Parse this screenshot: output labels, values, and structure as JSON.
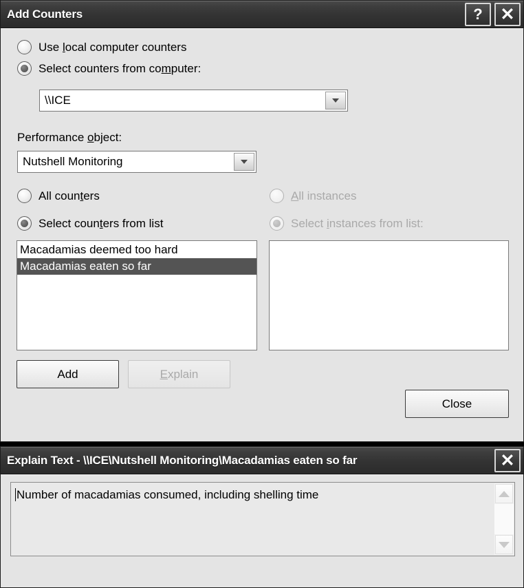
{
  "add_counters_window": {
    "title": "Add Counters",
    "title_buttons": {
      "help": "?",
      "close": "✕"
    },
    "source": {
      "local_option_label_pre": "Use ",
      "local_option_accel": "l",
      "local_option_label_post": "ocal computer counters",
      "remote_option_label_pre": "Select counters from co",
      "remote_option_accel": "m",
      "remote_option_label_post": "puter:",
      "selected": "remote",
      "computer_value": "\\\\ICE"
    },
    "performance_object": {
      "label_pre": "Performance ",
      "label_accel": "o",
      "label_post": "bject:",
      "value": "Nutshell Monitoring"
    },
    "counters": {
      "all_label_pre": "All coun",
      "all_label_accel": "t",
      "all_label_post": "ers",
      "select_label_pre": "Select coun",
      "select_label_accel": "t",
      "select_label_post": "ers from list",
      "selected": "select_from_list",
      "items": [
        {
          "label": "Macadamias deemed too hard",
          "selected": false
        },
        {
          "label": "Macadamias eaten so far",
          "selected": true
        }
      ]
    },
    "instances": {
      "all_label_pre": "",
      "all_label_accel": "A",
      "all_label_post": "ll instances",
      "select_label_pre": "Select ",
      "select_label_accel": "i",
      "select_label_post": "nstances from list:",
      "selected": "select_from_list",
      "disabled": true,
      "items": []
    },
    "buttons": {
      "add": "Add",
      "explain_pre": "",
      "explain_accel": "E",
      "explain_post": "xplain",
      "explain_disabled": true,
      "close": "Close"
    }
  },
  "explain_text_window": {
    "title": "Explain Text - \\\\ICE\\Nutshell Monitoring\\Macadamias eaten so far",
    "title_buttons": {
      "close": "✕"
    },
    "body_text": "Number of macadamias consumed, including shelling time",
    "scrollbar": {
      "up": "scroll-up",
      "down": "scroll-down",
      "disabled": true
    }
  },
  "colors": {
    "titlebar_dark": "#333333",
    "dialog_face": "#e4e4e4",
    "selection": "#545454",
    "disabled_text": "#a9a9a9"
  }
}
